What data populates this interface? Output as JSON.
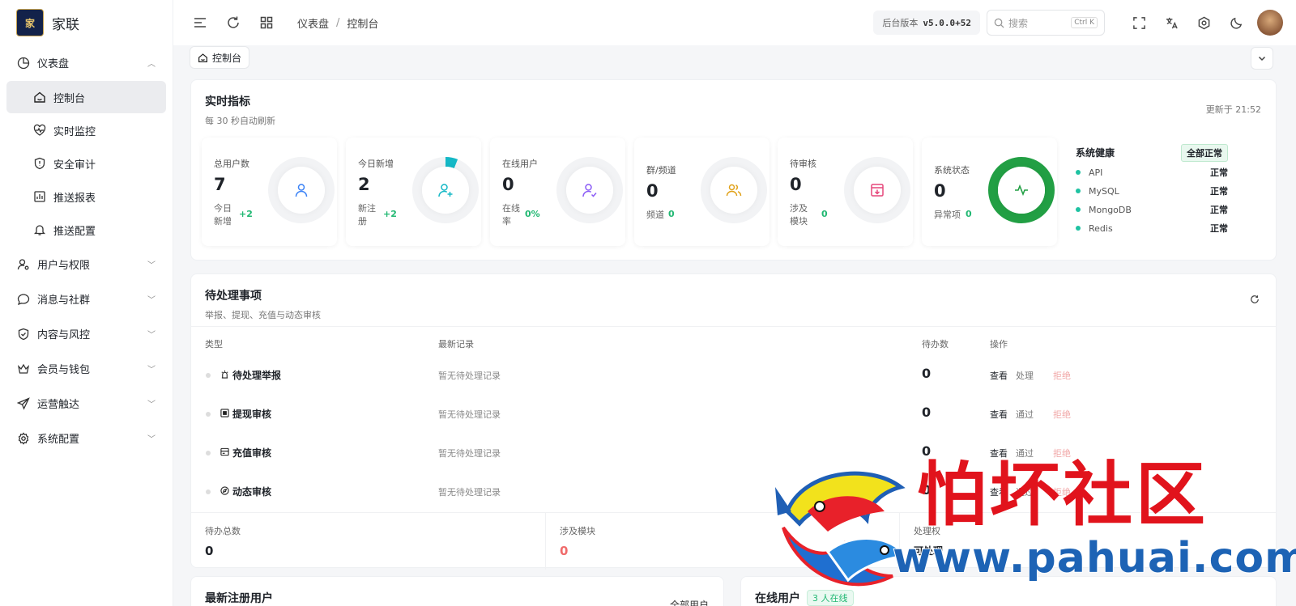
{
  "brand": {
    "logo_text": "家",
    "name": "家联"
  },
  "sidebar": {
    "groups": [
      {
        "label": "仪表盘",
        "icon": "pie-chart-icon",
        "expanded": true,
        "children": [
          {
            "label": "控制台",
            "icon": "home-icon",
            "active": true
          },
          {
            "label": "实时监控",
            "icon": "heart-pulse-icon"
          },
          {
            "label": "安全审计",
            "icon": "shield-icon"
          },
          {
            "label": "推送报表",
            "icon": "bar-chart-icon"
          },
          {
            "label": "推送配置",
            "icon": "bell-icon"
          }
        ]
      },
      {
        "label": "用户与权限",
        "icon": "user-gear-icon"
      },
      {
        "label": "消息与社群",
        "icon": "chat-bubble-icon"
      },
      {
        "label": "内容与风控",
        "icon": "shield-check-icon"
      },
      {
        "label": "会员与钱包",
        "icon": "crown-icon"
      },
      {
        "label": "运营触达",
        "icon": "send-icon"
      },
      {
        "label": "系统配置",
        "icon": "gear-icon"
      }
    ]
  },
  "header": {
    "breadcrumb": [
      "仪表盘",
      "控制台"
    ],
    "breadcrumb_sep": "/",
    "version_label": "后台版本",
    "version": "v5.0.0+52",
    "search_placeholder": "搜索",
    "search_shortcut": "Ctrl K"
  },
  "tabs": [
    {
      "label": "控制台",
      "icon": "home-icon"
    }
  ],
  "metrics": {
    "title": "实时指标",
    "subtitle": "每 30 秒自动刷新",
    "updated": "更新于 21:52",
    "cards": [
      {
        "label": "总用户数",
        "value": "7",
        "sub": "今日新增",
        "delta": "+2",
        "icon": "user-icon",
        "color": "#3b82f6"
      },
      {
        "label": "今日新增",
        "value": "2",
        "sub": "新注册",
        "delta": "+2",
        "icon": "user-plus-icon",
        "color": "#14b8c6",
        "ring_progress": 0.06
      },
      {
        "label": "在线用户",
        "value": "0",
        "sub": "在线率",
        "delta": "0%",
        "icon": "user-check-icon",
        "color": "#8b5cf6"
      },
      {
        "label": "群/频道",
        "value": "0",
        "sub": "频道",
        "delta": "0",
        "icon": "users-icon",
        "color": "#e0a21b"
      },
      {
        "label": "待审核",
        "value": "0",
        "sub": "涉及模块",
        "delta": "0",
        "icon": "inbox-icon",
        "color": "#e5467a"
      },
      {
        "label": "系统状态",
        "value": "0",
        "sub": "异常项",
        "delta": "0",
        "icon": "activity-icon",
        "color": "#229f44",
        "ring_progress": 1.0
      }
    ],
    "health": {
      "title": "系统健康",
      "badge": "全部正常",
      "items": [
        {
          "name": "API",
          "status": "正常"
        },
        {
          "name": "MySQL",
          "status": "正常"
        },
        {
          "name": "MongoDB",
          "status": "正常"
        },
        {
          "name": "Redis",
          "status": "正常"
        }
      ]
    }
  },
  "pending": {
    "title": "待处理事项",
    "subtitle": "举报、提现、充值与动态审核",
    "columns": [
      "类型",
      "最新记录",
      "待办数",
      "操作"
    ],
    "rows": [
      {
        "name": "待处理举报",
        "icon": "alarm-icon",
        "latest": "暂无待处理记录",
        "count": "0",
        "view": "查看",
        "action": "处理",
        "reject": "拒绝"
      },
      {
        "name": "提现审核",
        "icon": "wallet-icon",
        "latest": "暂无待处理记录",
        "count": "0",
        "view": "查看",
        "action": "通过",
        "reject": "拒绝"
      },
      {
        "name": "充值审核",
        "icon": "card-icon",
        "latest": "暂无待处理记录",
        "count": "0",
        "view": "查看",
        "action": "通过",
        "reject": "拒绝"
      },
      {
        "name": "动态审核",
        "icon": "compass-icon",
        "latest": "暂无待处理记录",
        "count": "0",
        "view": "查看",
        "action": "通过",
        "reject": "拒绝"
      }
    ],
    "summary": [
      {
        "label": "待办总数",
        "value": "0"
      },
      {
        "label": "涉及模块",
        "value": "0"
      },
      {
        "label": "处理权",
        "value": "可处理"
      }
    ]
  },
  "new_users": {
    "title": "最新注册用户",
    "link": "全部用户"
  },
  "online_users": {
    "title": "在线用户",
    "badge": "3 人在线"
  },
  "watermark": {
    "text": "怕坏社区",
    "url": "www.pahuai.com"
  }
}
